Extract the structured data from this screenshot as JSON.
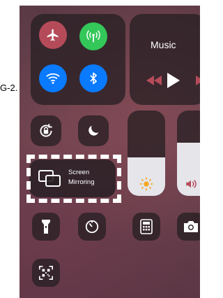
{
  "side_text": "G-2.",
  "music": {
    "title": "Music"
  },
  "screen_mirroring": {
    "line1": "Screen",
    "line2": "Mirroring"
  },
  "levels": {
    "brightness": 0.45,
    "volume": 0.62
  },
  "colors": {
    "airplane": "#b54b59",
    "cellular": "#34c759",
    "wifi": "#0a7aff",
    "bluetooth": "#0a7aff",
    "accent_rose": "#b54b59"
  },
  "icons": [
    "airplane-icon",
    "cellular-icon",
    "wifi-icon",
    "bluetooth-icon",
    "rewind-icon",
    "play-icon",
    "fast-forward-icon",
    "rotation-lock-icon",
    "moon-icon",
    "sun-icon",
    "speaker-icon",
    "screen-mirroring-icon",
    "flashlight-icon",
    "timer-icon",
    "calculator-icon",
    "camera-icon",
    "qr-code-icon"
  ]
}
